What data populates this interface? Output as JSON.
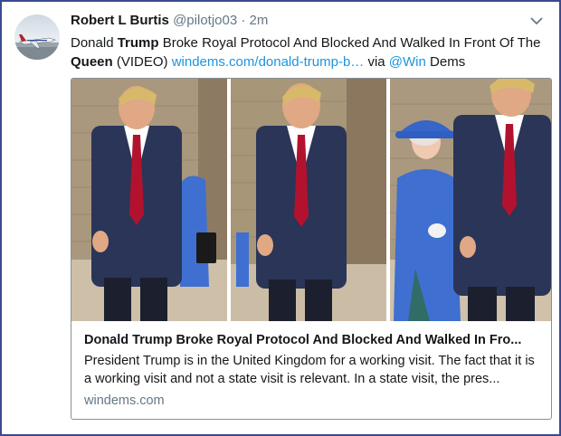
{
  "tweet": {
    "author_name": "Robert L Burtis",
    "handle": "@pilotjo03",
    "separator": "·",
    "time": "2m",
    "text_pre": "Donald ",
    "text_bold1": "Trump",
    "text_mid1": " Broke Royal Protocol And Blocked And Walked In Front Of The ",
    "text_bold2": "Queen",
    "text_mid2": " (VIDEO) ",
    "link_text": "windems.com/donald-trump-b…",
    "via_text": " via ",
    "mention": "@Win",
    "trailing_text": " Dems"
  },
  "card": {
    "title": "Donald Trump Broke Royal Protocol And Blocked And Walked In Fro...",
    "description": "President Trump is in the United Kingdom for a working visit. The fact that it is a working visit and not a state visit is relevant. In a state visit, the pres...",
    "domain": "windems.com"
  },
  "icons": {
    "menu": "chevron-down-icon",
    "avatar": "airplane-avatar"
  },
  "colors": {
    "link": "#1b95e0",
    "frame": "#3b4a8f",
    "muted": "#657786",
    "suit": "#2a3558",
    "tie": "#b3122e",
    "queen_blue": "#3f6fd0"
  }
}
